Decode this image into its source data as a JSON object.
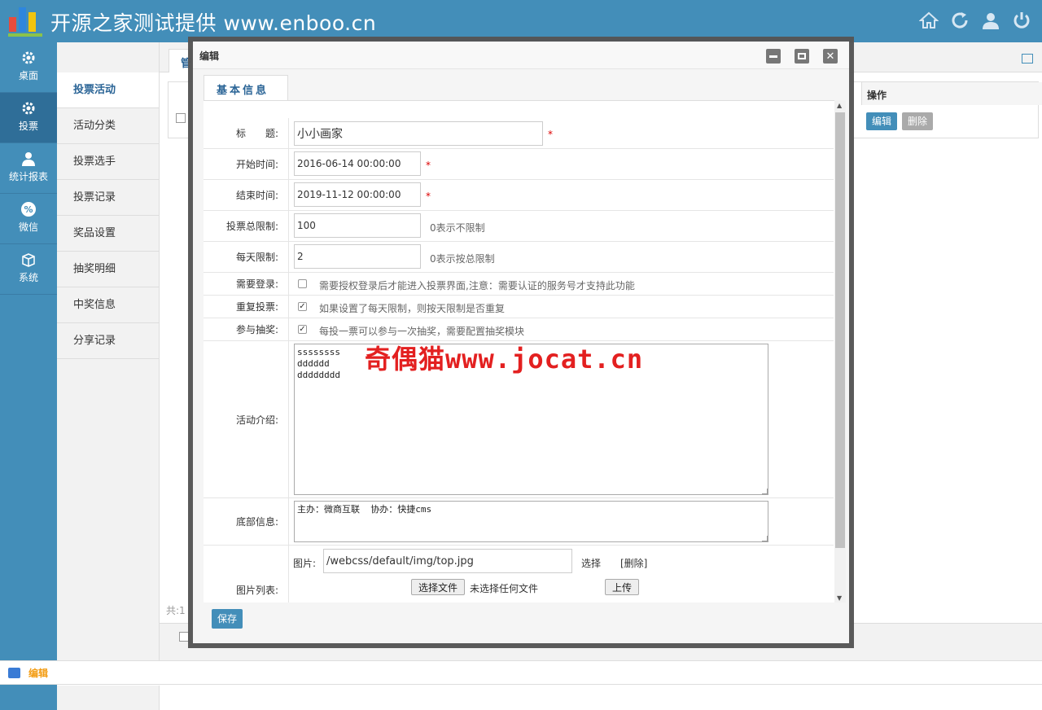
{
  "header": {
    "title": "开源之家测试提供 www.enboo.cn",
    "icons": [
      "home-icon",
      "refresh-icon",
      "user-icon",
      "power-icon"
    ]
  },
  "leftnav": {
    "items": [
      {
        "label": "桌面",
        "icon": "gear-icon",
        "active": false
      },
      {
        "label": "投票",
        "icon": "gear-icon",
        "active": true
      },
      {
        "label": "统计报表",
        "icon": "user-icon",
        "active": false
      },
      {
        "label": "微信",
        "icon": "percent-icon",
        "active": false
      },
      {
        "label": "系统",
        "icon": "box-icon",
        "active": false
      }
    ]
  },
  "submenu": {
    "items": [
      "投票活动",
      "活动分类",
      "投票选手",
      "投票记录",
      "奖品设置",
      "抽奖明细",
      "中奖信息",
      "分享记录"
    ],
    "active_index": 0
  },
  "background": {
    "tab_label": "管",
    "op_header": "操作",
    "edit_label": "编辑",
    "delete_label": "删除",
    "total_label": "共:1"
  },
  "statusbar": {
    "text": "编辑"
  },
  "modal": {
    "title": "编辑",
    "tab_label": "基本信息",
    "fields": {
      "title": {
        "label": "标　　题:",
        "value": "小小画家",
        "required": "*"
      },
      "start_time": {
        "label": "开始时间:",
        "value": "2016-06-14 00:00:00",
        "required": "*"
      },
      "end_time": {
        "label": "结束时间:",
        "value": "2019-11-12 00:00:00",
        "required": "*"
      },
      "total_limit": {
        "label": "投票总限制:",
        "value": "100",
        "hint": "0表示不限制"
      },
      "daily_limit": {
        "label": "每天限制:",
        "value": "2",
        "hint": "0表示按总限制"
      },
      "need_login": {
        "label": "需要登录:",
        "checked": false,
        "hint": "需要授权登录后才能进入投票界面,注意：需要认证的服务号才支持此功能"
      },
      "repeat_vote": {
        "label": "重复投票:",
        "checked": true,
        "hint": "如果设置了每天限制，则按天限制是否重复"
      },
      "lottery": {
        "label": "参与抽奖:",
        "checked": true,
        "hint": "每投一票可以参与一次抽奖，需要配置抽奖模块"
      },
      "intro": {
        "label": "活动介绍:",
        "value": "ssssssss\ndddddd\ndddddddd"
      },
      "footer_info": {
        "label": "底部信息:",
        "value": "主办：微商互联  协办：快捷cms"
      },
      "images": {
        "label": "图片列表:",
        "image_label": "图片:",
        "image_value": "/webcss/default/img/top.jpg",
        "select_link": "选择",
        "delete_link": "[删除]",
        "choose_file": "选择文件",
        "no_file": "未选择任何文件",
        "upload": "上传"
      }
    },
    "save_label": "保存"
  },
  "watermark": "奇偶猫www.jocat.cn"
}
